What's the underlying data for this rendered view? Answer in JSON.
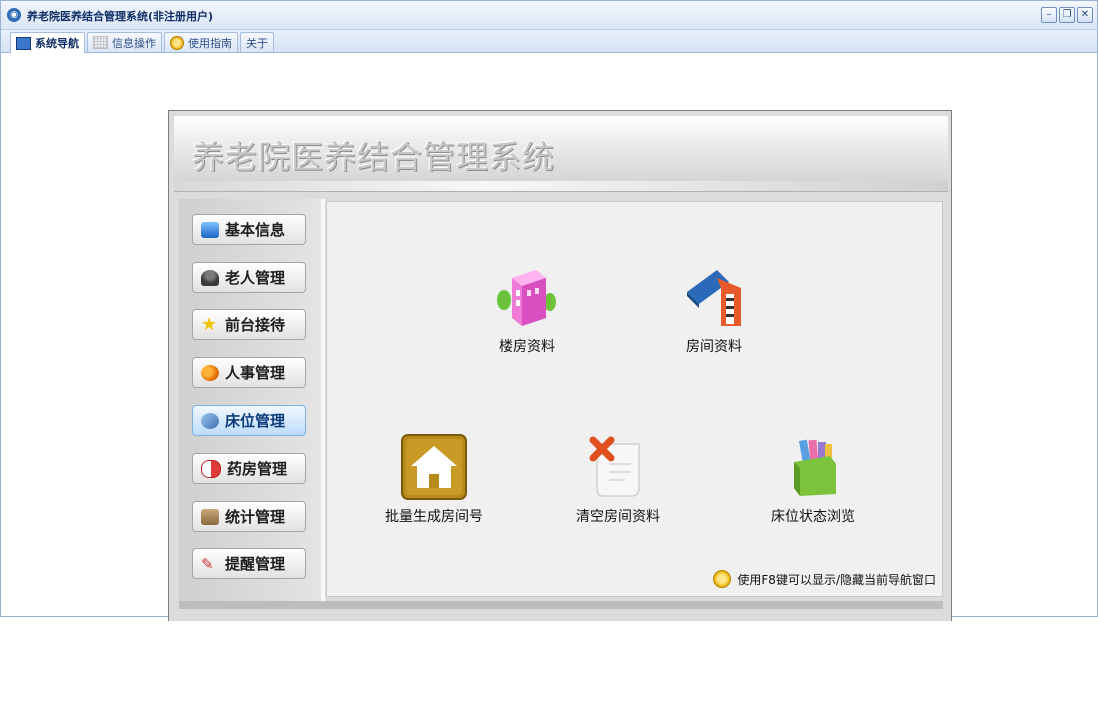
{
  "window": {
    "title": "养老院医养结合管理系统(非注册用户)",
    "controls": [
      "–",
      "❐",
      "✕"
    ]
  },
  "tabs": [
    {
      "label": "系统导航",
      "icon": "nav-icon"
    },
    {
      "label": "信息操作",
      "icon": "grid-icon"
    },
    {
      "label": "使用指南",
      "icon": "guide-icon"
    },
    {
      "label": "关于",
      "icon": ""
    }
  ],
  "app_title": "养老院医养结合管理系统",
  "sidebar": {
    "items": [
      {
        "label": "基本信息",
        "icon": "monitor-icon",
        "color": "#2d7ad6"
      },
      {
        "label": "老人管理",
        "icon": "person-icon",
        "color": "#5a5a5a"
      },
      {
        "label": "前台接待",
        "icon": "star-icon",
        "color": "#f0c400"
      },
      {
        "label": "人事管理",
        "icon": "people-icon",
        "color": "#f08a00"
      },
      {
        "label": "床位管理",
        "icon": "bed-icon",
        "color": "#4a78b8"
      },
      {
        "label": "药房管理",
        "icon": "pills-icon",
        "color": "#e03b3b"
      },
      {
        "label": "统计管理",
        "icon": "folder-icon",
        "color": "#9a7b4f"
      },
      {
        "label": "提醒管理",
        "icon": "pushpin-icon",
        "color": "#d23030"
      }
    ],
    "active": "床位管理"
  },
  "main": {
    "items": [
      {
        "label": "楼房资料",
        "icon": "building-icon"
      },
      {
        "label": "房间资料",
        "icon": "room-icon"
      },
      {
        "label": "批量生成房间号",
        "icon": "house-icon"
      },
      {
        "label": "清空房间资料",
        "icon": "delete-document-icon"
      },
      {
        "label": "床位状态浏览",
        "icon": "books-icon"
      }
    ],
    "hint": "使用F8键可以显示/隐藏当前导航窗口"
  },
  "colors": {
    "titlebar": "#dbe6f6",
    "accent": "#2b4f89",
    "active_sidebar": "#bcdcfb"
  }
}
